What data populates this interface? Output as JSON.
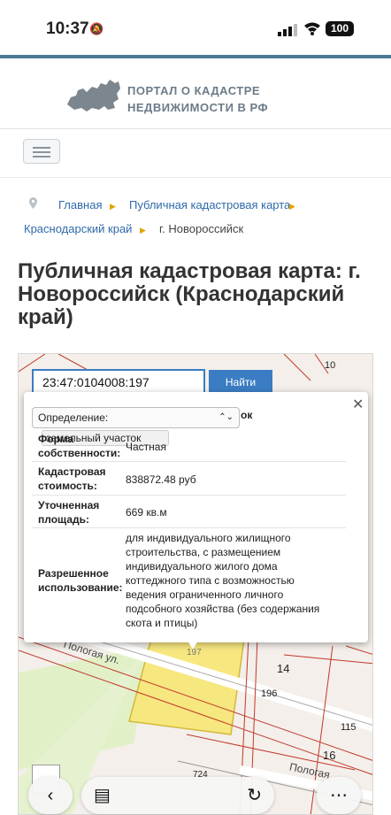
{
  "status": {
    "time": "10:37",
    "battery": "100"
  },
  "header": {
    "logo_line1": "ПОРТАЛ О КАДАСТРЕ",
    "logo_line2": "НЕДВИЖИМОСТИ В РФ"
  },
  "breadcrumbs": [
    "Главная",
    "Публичная кадастровая карта",
    "Краснодарский край",
    "г. Новороссийск"
  ],
  "page_title": "Публичная кадастровая карта: г. Новороссийск (Краснодарский край)",
  "search": {
    "value": "23:47:0104008:197",
    "button": "Найти"
  },
  "map_labels": {
    "l10": "10",
    "l14": "14",
    "l196": "196",
    "l115": "115",
    "l16": "16",
    "l724": "724",
    "street1": "Пологая ул.",
    "street2": "Пологая",
    "l197": "197"
  },
  "popup": {
    "def_label": "Определение:",
    "def_value": "земельный участок",
    "tail": "ок",
    "rows": [
      {
        "label": "Форма собственности:",
        "value": "Частная"
      },
      {
        "label": "Кадастровая стоимость:",
        "value": "838872.48 руб"
      },
      {
        "label": "Уточненная площадь:",
        "value": "669 кв.м"
      },
      {
        "label": "Разрешенное использование:",
        "value": "для индивидуального жилищного строительства, с размещением индивидуального жилого дома коттеджного типа с возможностью ведения ограниченного личного подсобного хозяйства (без содержания скота и птицы)"
      }
    ]
  },
  "colors": {
    "accent": "#3b7dc4",
    "parcel": "#f7e77f",
    "green": "#d9edb4"
  },
  "icons": [
    "bell-off-icon",
    "signal-icon",
    "wifi-icon",
    "pin-icon",
    "close-icon",
    "chevron-icon",
    "back-icon",
    "tabs-icon",
    "share-icon",
    "more-icon"
  ]
}
